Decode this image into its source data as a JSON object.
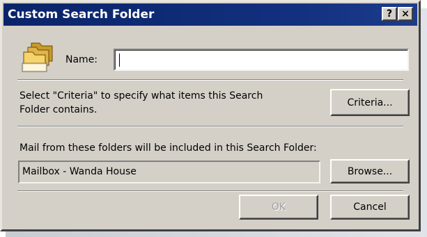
{
  "window": {
    "title": "Custom Search Folder",
    "help_button": "?",
    "close_button": "×"
  },
  "name_field": {
    "label": "Name:",
    "value": ""
  },
  "criteria": {
    "description_line1": "Select \"Criteria\" to specify what items this Search",
    "description_line2": "Folder contains.",
    "button_label": "Criteria..."
  },
  "folders": {
    "description": "Mail from these folders will be included in this Search Folder:",
    "value": "Mailbox - Wanda House",
    "browse_label": "Browse..."
  },
  "footer": {
    "ok_label": "OK",
    "cancel_label": "Cancel",
    "ok_enabled": false
  },
  "icons": {
    "folder": "search-folder-icon"
  },
  "colors": {
    "titlebar": "#0a246a",
    "dialog_face": "#d4d0c8"
  }
}
